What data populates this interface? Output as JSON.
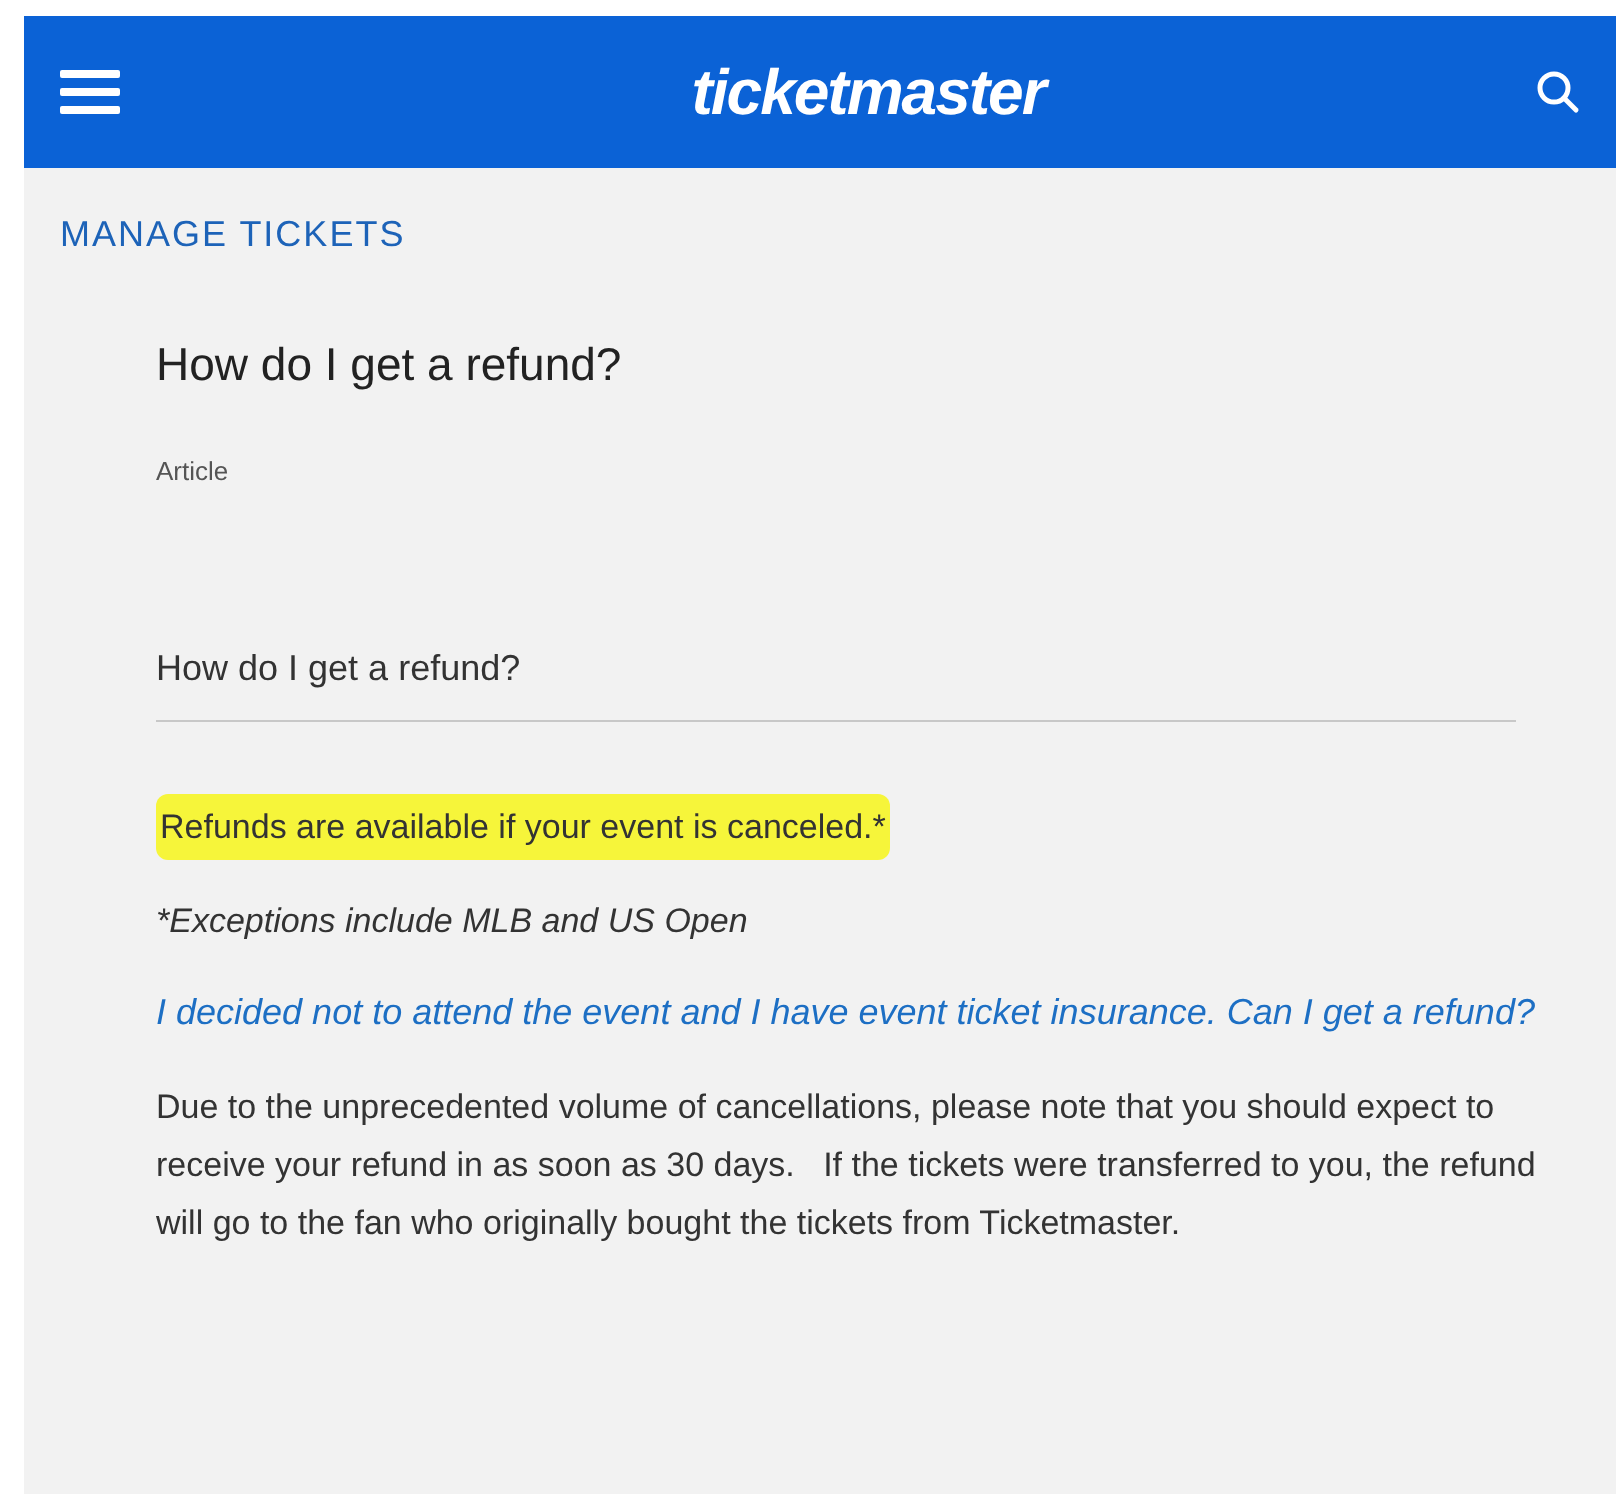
{
  "header": {
    "logo": "ticketmaster"
  },
  "breadcrumb": "MANAGE TICKETS",
  "article": {
    "title": "How do I get a refund?",
    "type_label": "Article",
    "question": "How do I get a refund?",
    "paragraphs": [
      {
        "kind": "text",
        "text": "Refunds are available if your event is canceled.*",
        "highlighted": true
      },
      {
        "kind": "note",
        "text": "*Exceptions include MLB and US Open",
        "highlighted": false
      },
      {
        "kind": "link",
        "text": "I decided not to attend the event and I have event ticket insurance. Can I get a refund?",
        "highlighted": false
      },
      {
        "kind": "text",
        "text": "Due to the unprecedented volume of cancellations, please note that you should expect to receive your refund in as soon as 30 days.   If the tickets were transferred to you, the refund will go to the fan who originally bought the tickets from Ticketmaster.",
        "highlighted": false
      }
    ]
  }
}
